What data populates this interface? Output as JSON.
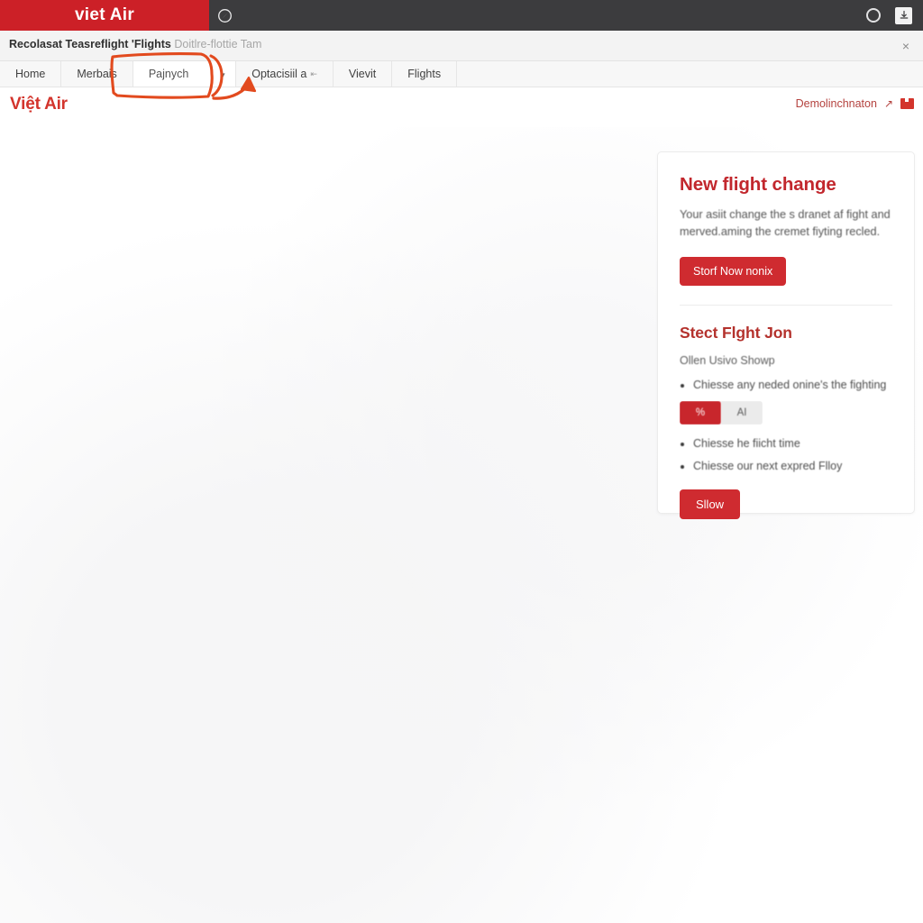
{
  "browser": {
    "tab_title": "viet Air",
    "tab_icon": "compass-icon",
    "right_icons": [
      {
        "name": "circle-icon",
        "glyph": "○"
      },
      {
        "name": "save-page-icon",
        "glyph": "⬇"
      }
    ]
  },
  "info_bar": {
    "bold_text": "Recolasat Teasreflight 'Flights",
    "muted_text": "Doitlre-flottie Tam",
    "close_label": "×"
  },
  "nav": {
    "tabs": [
      {
        "label": "Home",
        "type": "tab"
      },
      {
        "label": "Merbais",
        "type": "tab"
      },
      {
        "label": "Pajnych",
        "type": "dropdown",
        "caret": "▼"
      },
      {
        "label": "Optacisiil a",
        "type": "tab",
        "suffix": "⇤"
      },
      {
        "label": "Vievit",
        "type": "tab"
      },
      {
        "label": "Flights",
        "type": "tab"
      }
    ]
  },
  "site_header": {
    "logo": "Việt Air",
    "account_label": "Demolinchnaton",
    "arrow_icon": "↗",
    "flag_icon": "flag-icon"
  },
  "card": {
    "title": "New flight change",
    "paragraph": "Your asiit change the s dranet af fight and merved.aming the cremet fiyting recled.",
    "primary_button": "Storf Now nonix",
    "subtitle": "Stect Flght Jon",
    "subnote": "Ollen Usivo Showp",
    "bullets": [
      "Chiesse any neded onine's the fighting",
      "Chiesse he fiicht time",
      "Chiesse our next expred Flloy"
    ],
    "toggle": {
      "options": [
        "%",
        "AI"
      ],
      "selected": "%"
    },
    "secondary_button": "Sllow"
  },
  "annotation": {
    "color": "#E24A1E",
    "box_target": "Pajnych dropdown",
    "arrow_target": "Optacisiil a tab"
  }
}
